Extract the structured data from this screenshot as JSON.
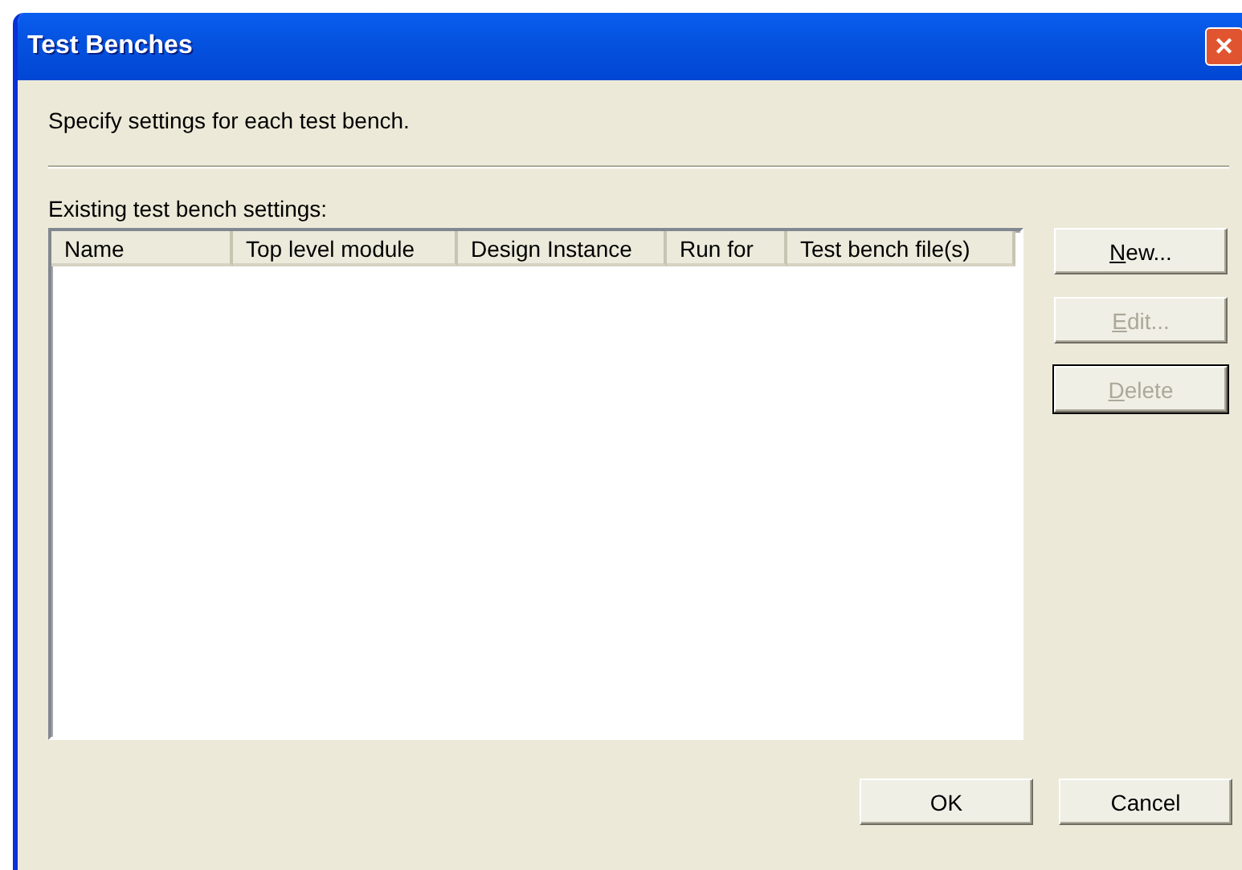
{
  "window": {
    "title": "Test Benches",
    "close": "✕"
  },
  "intro": "Specify settings for each test bench.",
  "list_label": "Existing test bench settings:",
  "table": {
    "columns": [
      "Name",
      "Top level module",
      "Design Instance",
      "Run for",
      "Test bench file(s)"
    ]
  },
  "side_buttons": [
    {
      "key": "N",
      "rest": "ew...",
      "disabled": false,
      "focused": false
    },
    {
      "key": "E",
      "rest": "dit...",
      "disabled": true,
      "focused": false
    },
    {
      "key": "D",
      "rest": "elete",
      "disabled": true,
      "focused": true
    }
  ],
  "buttons": [
    {
      "label": "OK",
      "disabled": false
    },
    {
      "label": "Cancel",
      "disabled": false
    }
  ]
}
